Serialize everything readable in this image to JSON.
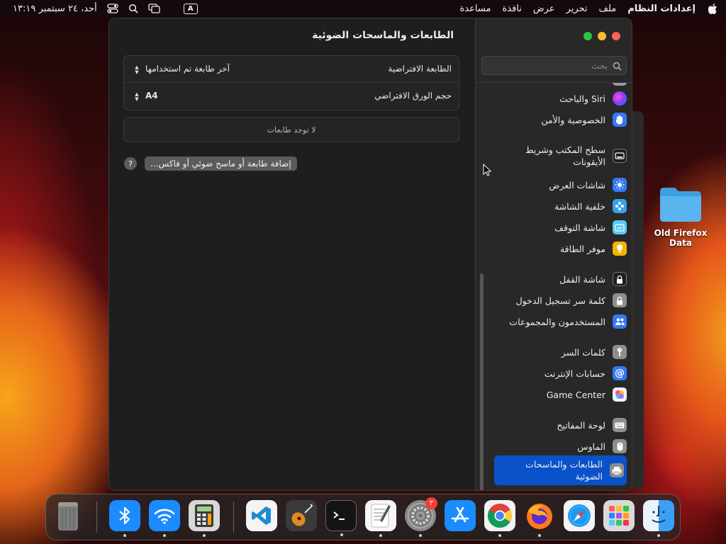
{
  "menubar": {
    "app_name": "إعدادات النظام",
    "menus": [
      "ملف",
      "تحرير",
      "عرض",
      "نافذة",
      "مساعدة"
    ],
    "clock": "أحد، ٢٤ سبتمبر ١٣:١٩",
    "input_indicator": "A"
  },
  "window": {
    "title": "الطابعات والماسحات الضوئية",
    "default_printer_label": "الطابعة الافتراضية",
    "default_printer_value": "آخر طابعة تم استخدامها",
    "paper_size_label": "حجم الورق الافتراضي",
    "paper_size_value": "A4",
    "no_printers": "لا توجد طابعات",
    "add_button": "إضافة طابعة أو ماسح ضوئي أو فاكس...",
    "help": "?"
  },
  "sidebar": {
    "search_placeholder": "بحث",
    "items": [
      {
        "label": "Siri والباحث",
        "icon": "siri-icon",
        "color": "#8e44ff"
      },
      {
        "label": "الخصوصية والأمن",
        "icon": "hand-icon",
        "color": "#3478f6"
      },
      {
        "label": "سطح المكتب وشريط الأيقونات",
        "icon": "dock-icon",
        "color": "#2b2b2b"
      },
      {
        "label": "شاشات العرض",
        "icon": "display-icon",
        "color": "#3478f6"
      },
      {
        "label": "خلفية الشاشة",
        "icon": "wallpaper-icon",
        "color": "#36a3e8"
      },
      {
        "label": "شاشة التوقف",
        "icon": "screensaver-icon",
        "color": "#5ac8fa"
      },
      {
        "label": "موفر الطاقة",
        "icon": "lightbulb-icon",
        "color": "#f5b400"
      },
      {
        "label": "شاشة القفل",
        "icon": "lock-icon",
        "color": "#2b2b2b"
      },
      {
        "label": "كلمة سر تسجيل الدخول",
        "icon": "padlock-icon",
        "color": "#8e8e8e"
      },
      {
        "label": "المستخدمون والمجموعات",
        "icon": "users-icon",
        "color": "#3478f6"
      },
      {
        "label": "كلمات السر",
        "icon": "key-icon",
        "color": "#8e8e8e"
      },
      {
        "label": "حسابات الإنترنت",
        "icon": "at-icon",
        "color": "#3478f6"
      },
      {
        "label": "Game Center",
        "icon": "game-center-icon",
        "color": "#f0f0f0"
      },
      {
        "label": "لوحة المفاتيح",
        "icon": "keyboard-icon",
        "color": "#8e8e8e"
      },
      {
        "label": "الماوس",
        "icon": "mouse-icon",
        "color": "#8e8e8e"
      },
      {
        "label": "الطابعات والماسحات الضوئية",
        "icon": "printer-icon",
        "color": "#8e8e8e"
      }
    ]
  },
  "desktop": {
    "folder_label": "Old Firefox Data"
  },
  "dock": {
    "apps": [
      "Trash",
      "Bluetooth",
      "Wi-Fi",
      "Calculator",
      "Visual Studio Code",
      "GarageBand",
      "Terminal",
      "TextEdit",
      "System Settings",
      "App Store",
      "Google Chrome",
      "Firefox",
      "Safari",
      "Launchpad",
      "Finder"
    ],
    "settings_badge": "٣"
  }
}
